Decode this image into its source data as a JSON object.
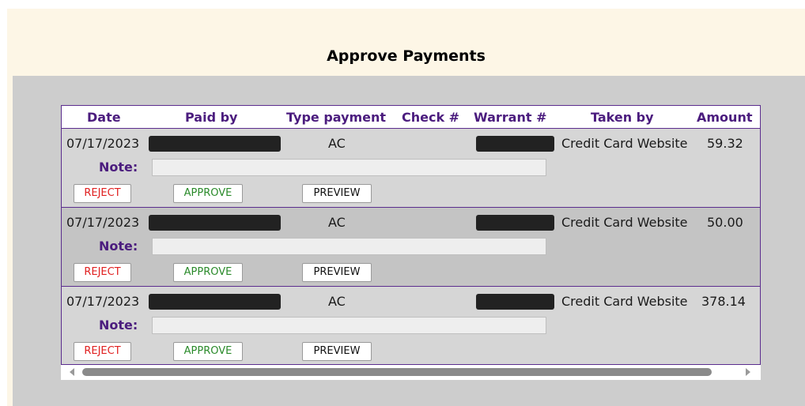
{
  "page": {
    "title": "Approve Payments"
  },
  "table": {
    "columns": {
      "date": "Date",
      "paid_by": "Paid by",
      "type_payment": "Type payment",
      "check_no": "Check #",
      "warrant_no": "Warrant #",
      "taken_by": "Taken by",
      "amount": "Amount"
    },
    "note_label": "Note:",
    "buttons": {
      "reject": "REJECT",
      "approve": "APPROVE",
      "preview": "PREVIEW"
    },
    "rows": [
      {
        "date": "07/17/2023",
        "type_payment": "AC",
        "taken_by": "Credit Card Website",
        "amount": "59.32",
        "note": ""
      },
      {
        "date": "07/17/2023",
        "type_payment": "AC",
        "taken_by": "Credit Card Website",
        "amount": "50.00",
        "note": ""
      },
      {
        "date": "07/17/2023",
        "type_payment": "AC",
        "taken_by": "Credit Card Website",
        "amount": "378.14",
        "note": ""
      }
    ]
  },
  "colors": {
    "header_bg": "#fdf6e6",
    "panel_bg": "#cdcdcd",
    "accent_purple": "#4b1c7e",
    "reject_red": "#e02020",
    "approve_green": "#2a8a2a"
  },
  "icons": {
    "scroll_left": "scroll-left-arrow-icon",
    "scroll_right": "scroll-right-arrow-icon"
  }
}
